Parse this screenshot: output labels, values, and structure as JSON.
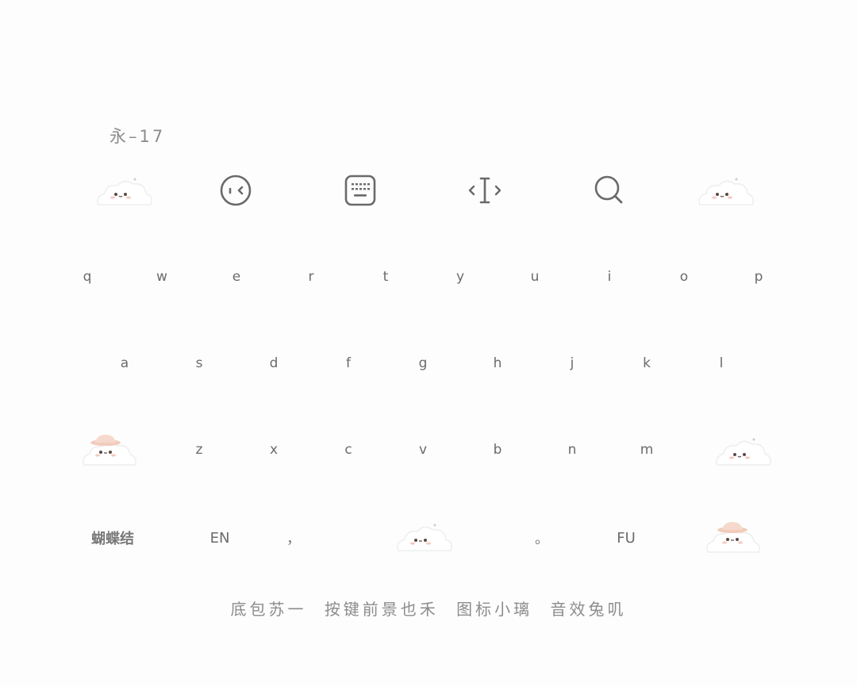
{
  "header": {
    "title": "永–17"
  },
  "toolbar": {
    "items": [
      {
        "icon": "cloud-mascot-icon"
      },
      {
        "icon": "emoji-face-icon"
      },
      {
        "icon": "keyboard-icon"
      },
      {
        "icon": "text-cursor-icon"
      },
      {
        "icon": "search-icon"
      },
      {
        "icon": "cloud-mascot-icon"
      }
    ]
  },
  "keyboard": {
    "row1": [
      "q",
      "w",
      "e",
      "r",
      "t",
      "y",
      "u",
      "i",
      "o",
      "p"
    ],
    "row2": [
      "a",
      "s",
      "d",
      "f",
      "g",
      "h",
      "j",
      "k",
      "l"
    ],
    "row3": [
      "z",
      "x",
      "c",
      "v",
      "b",
      "n",
      "m"
    ],
    "row4": {
      "lang_switch": "蝴蝶结",
      "en": "EN",
      "comma": "，",
      "period": "。",
      "fu": "FU"
    }
  },
  "footer": {
    "credits": [
      "底包苏一",
      "按键前景也禾",
      "图标小璃",
      "音效兔叽"
    ]
  },
  "colors": {
    "background": "#fdfdfd",
    "key_text": "#6b6b6b",
    "icon_stroke": "#6a6a6a",
    "hat_pink": "#f2cbbd"
  }
}
